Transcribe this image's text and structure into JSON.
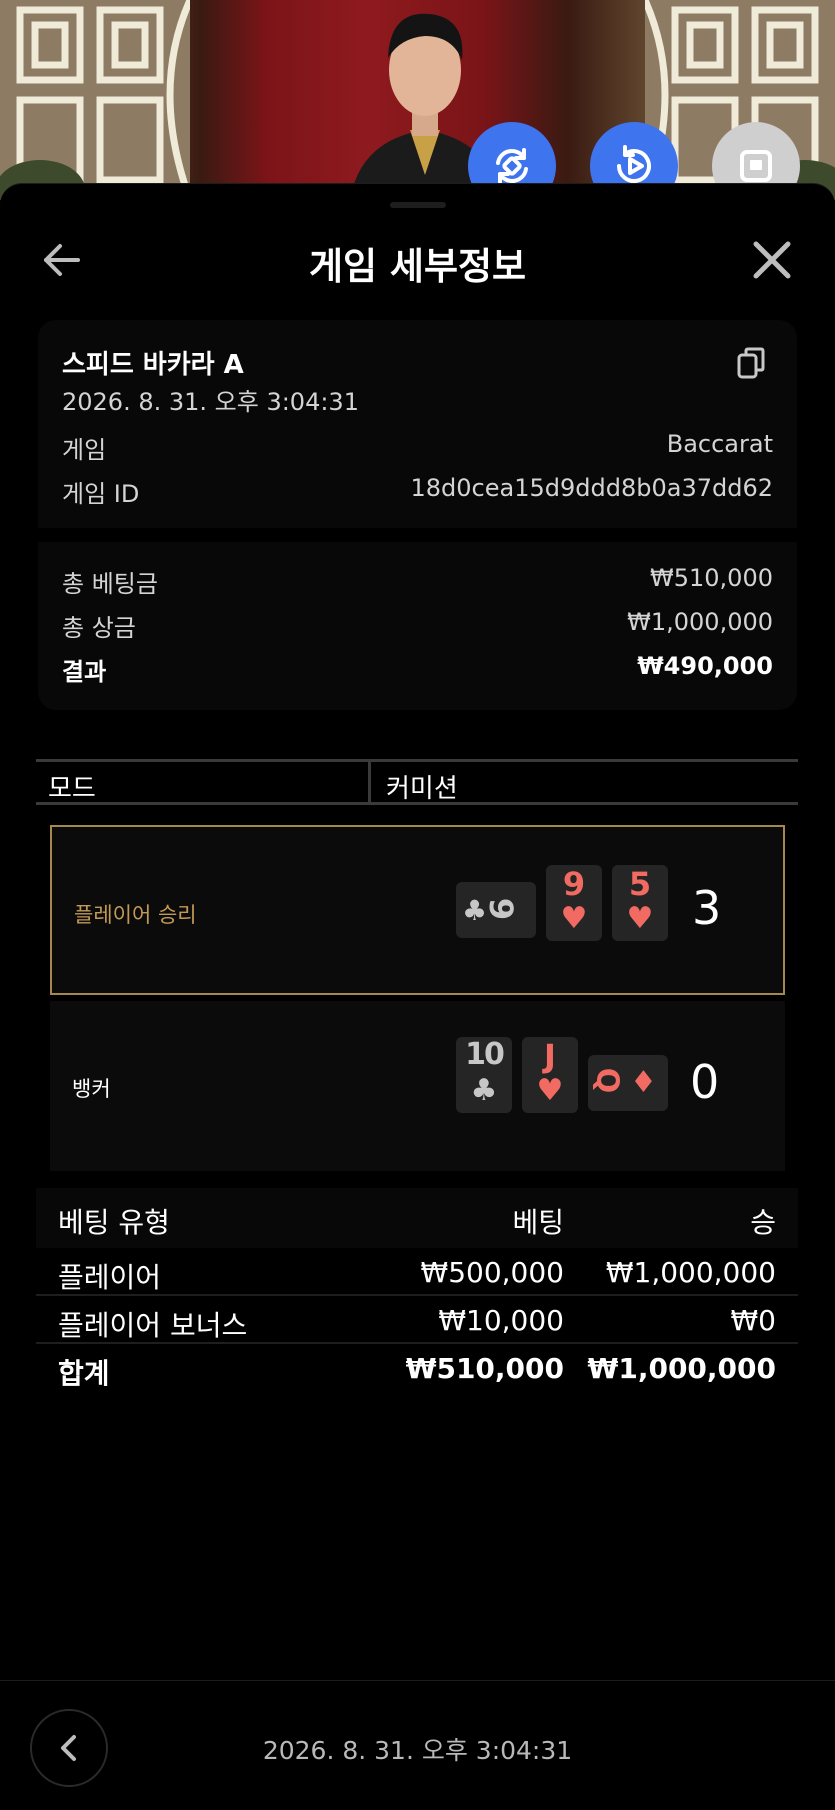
{
  "header": {
    "title": "게임 세부정보"
  },
  "summary": {
    "game_name": "스피드 바카라 A",
    "datetime": "2026. 8. 31. 오후 3:04:31",
    "game_label": "게임",
    "game_value": "Baccarat",
    "id_label": "게임 ID",
    "id_value": "18d0cea15d9ddd8b0a37dd62",
    "total_bet_label": "총 베팅금",
    "total_bet_value": "₩510,000",
    "total_win_label": "총 상금",
    "total_win_value": "₩1,000,000",
    "result_label": "결과",
    "result_value": "₩490,000"
  },
  "mode": {
    "col1": "모드",
    "col2": "커미션"
  },
  "hands": {
    "player": {
      "label": "플레이어 승리",
      "score": "3",
      "cards": [
        {
          "rank": "9",
          "suit": "♣",
          "color": "black",
          "rotated": true
        },
        {
          "rank": "9",
          "suit": "♥",
          "color": "red"
        },
        {
          "rank": "5",
          "suit": "♥",
          "color": "red"
        }
      ]
    },
    "banker": {
      "label": "뱅커",
      "score": "0",
      "cards": [
        {
          "rank": "10",
          "suit": "♣",
          "color": "black"
        },
        {
          "rank": "J",
          "suit": "♥",
          "color": "red"
        },
        {
          "rank": "Q",
          "suit": "♦",
          "color": "red",
          "rotated": true
        }
      ]
    }
  },
  "bets": {
    "headers": {
      "type": "베팅 유형",
      "bet": "베팅",
      "win": "승"
    },
    "rows": [
      {
        "type": "플레이어",
        "bet": "₩500,000",
        "win": "₩1,000,000"
      },
      {
        "type": "플레이어 보너스",
        "bet": "₩10,000",
        "win": "₩0"
      }
    ],
    "total": {
      "type": "합계",
      "bet": "₩510,000",
      "win": "₩1,000,000"
    }
  },
  "footer": {
    "datetime": "2026. 8. 31. 오후 3:04:31"
  },
  "icons": {
    "fab1": "rotate-icon",
    "fab2": "replay-icon",
    "fab3": "stop-icon",
    "back": "arrow-left-icon",
    "close": "close-icon",
    "copy": "copy-icon",
    "prev": "chevron-left-icon"
  },
  "colors": {
    "accent_blue": "#3f74ef",
    "winner_border": "#a6874d",
    "winner_text": "#c29a55",
    "red_suit": "#f26b62"
  }
}
